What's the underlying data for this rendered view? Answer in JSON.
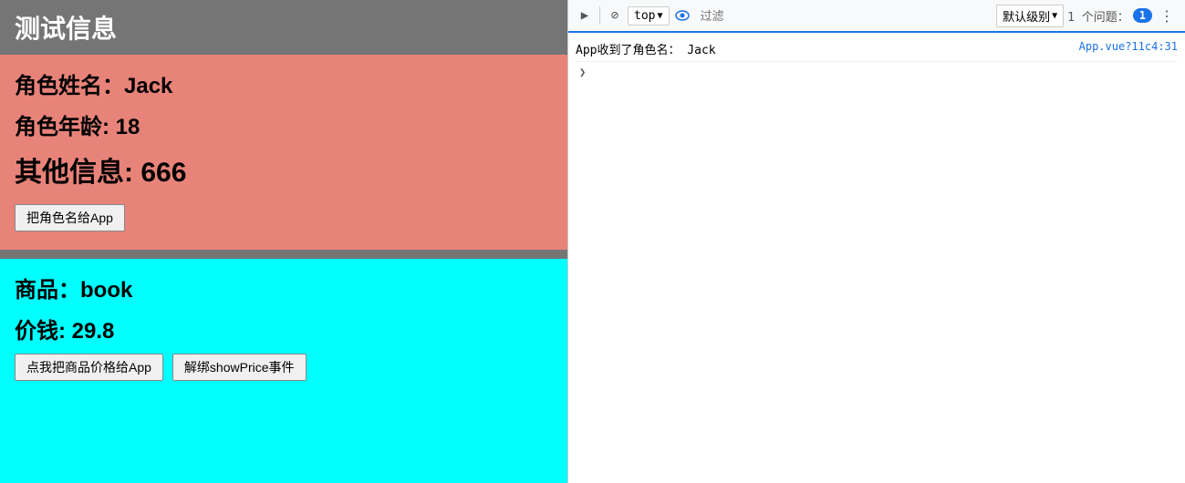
{
  "left": {
    "title": "测试信息",
    "salmon_section": {
      "role_name_label": "角色姓名：",
      "role_name_value": "Jack",
      "role_age_label": "角色年龄:",
      "role_age_value": "18",
      "other_info_label": "其他信息:",
      "other_info_value": "666",
      "btn_give_name": "把角色名给App"
    },
    "cyan_section": {
      "product_label": "商品：",
      "product_value": "book",
      "price_label": "价钱:",
      "price_value": "29.8",
      "btn_give_price": "点我把商品价格给App",
      "btn_unbind": "解绑showPrice事件"
    }
  },
  "devtools": {
    "toolbar": {
      "play_icon": "▶",
      "block_icon": "⊘",
      "top_label": "top",
      "chevron": "▼",
      "filter_placeholder": "过滤",
      "level_label": "默认级别",
      "issues_label": "1 个问题：",
      "issues_count": "1",
      "more_icon": "⋮"
    },
    "log_entry": {
      "text": "App收到了角色名：   Jack",
      "source": "App.vue?11c4:31"
    }
  }
}
